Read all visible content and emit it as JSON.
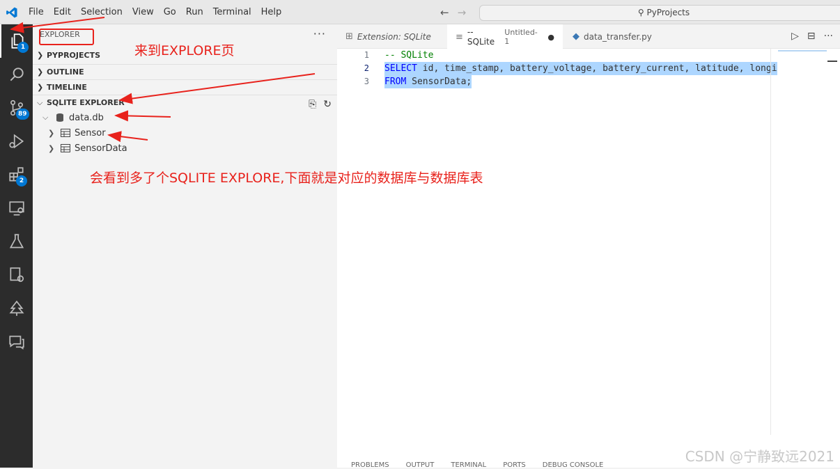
{
  "titlebar": {
    "menu": [
      "File",
      "Edit",
      "Selection",
      "View",
      "Go",
      "Run",
      "Terminal",
      "Help"
    ],
    "search": "PyProjects"
  },
  "activity_bar": {
    "explorer_badge": "1",
    "source_control_badge": "89",
    "extensions_badge": "2"
  },
  "sidebar": {
    "header": "EXPLORER",
    "sections": {
      "pyprojects": "PYPROJECTS",
      "outline": "OUTLINE",
      "timeline": "TIMELINE",
      "sqlite": "SQLITE EXPLORER"
    },
    "tree": {
      "db": "data.db",
      "tables": [
        "Sensor",
        "SensorData"
      ]
    }
  },
  "tabs": [
    {
      "label": "Extension: SQLite",
      "active": false
    },
    {
      "label": "-- SQLite",
      "sublabel": "Untitled-1",
      "active": true
    },
    {
      "label": "data_transfer.py",
      "active": false
    }
  ],
  "editor": {
    "line_numbers": [
      "1",
      "2",
      "3"
    ],
    "lines": {
      "l1": "-- SQLite",
      "l2_kw": "SELECT",
      "l2_rest": " id, time_stamp, battery_voltage, battery_current, latitude, longi",
      "l3_kw": "FROM",
      "l3_rest": " SensorData;"
    }
  },
  "panel_tabs": [
    "PROBLEMS",
    "OUTPUT",
    "TERMINAL",
    "PORTS",
    "DEBUG CONSOLE"
  ],
  "annotations": {
    "top": "来到EXPLORE页",
    "bottom": "会看到多了个SQLITE EXPLORE,下面就是对应的数据库与数据库表"
  },
  "watermark": "CSDN @宁静致远2021",
  "colors": {
    "accent": "#0078d4",
    "annotation_red": "#e8221c",
    "selection": "#add6ff",
    "activity_bar": "#2c2c2c"
  }
}
